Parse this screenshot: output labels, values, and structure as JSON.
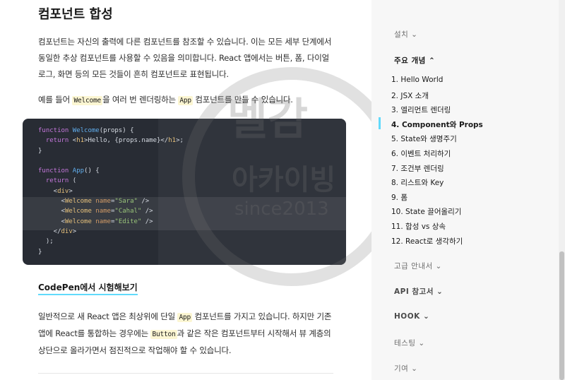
{
  "main": {
    "heading": "컴포넌트 합성",
    "p1": "컴포넌트는 자신의 출력에 다른 컴포넌트를 참조할 수 있습니다. 이는 모든 세부 단계에서 동일한 추상 컴포넌트를 사용할 수 있음을 의미합니다. React 앱에서는 버튼, 폼, 다이얼로그, 화면 등의 모든 것들이 흔히 컴포넌트로 표현됩니다.",
    "p2_before": "예를 들어 ",
    "p2_code1": "Welcome",
    "p2_mid": "을 여러 번 렌더링하는 ",
    "p2_code2": "App",
    "p2_after": " 컴포넌트를 만들 수 있습니다.",
    "code_lines": [
      "function Welcome(props) {",
      "  return <h1>Hello, {props.name}</h1>;",
      "}",
      "",
      "function App() {",
      "  return (",
      "    <div>",
      "      <Welcome name=\"Sara\" />",
      "      <Welcome name=\"Cahal\" />",
      "      <Welcome name=\"Edite\" />",
      "    </div>",
      "  );",
      "}"
    ],
    "codepen_link": "CodePen에서 시험해보기",
    "p3_before": "일반적으로 새 React 앱은 최상위에 단일 ",
    "p3_code1": "App",
    "p3_mid": " 컴포넌트를 가지고 있습니다. 하지만 기존 앱에 React를 통합하는 경우에는 ",
    "p3_code2": "Button",
    "p3_after": "과 같은 작은 컴포넌트부터 시작해서 뷰 계층의 상단으로 올라가면서 점진적으로 작업해야 할 수 있습니다."
  },
  "watermark": {
    "line1": "멜감",
    "line2": "아카이빙",
    "line3": "since2013"
  },
  "sidebar": {
    "install": "설치",
    "main_concepts": "주요 개념",
    "items": [
      "1. Hello World",
      "2. JSX 소개",
      "3. 엘리먼트 렌더링",
      "4. Component와 Props",
      "5. State와 생명주기",
      "6. 이벤트 처리하기",
      "7. 조건부 렌더링",
      "8. 리스트와 Key",
      "9. 폼",
      "10. State 끌어올리기",
      "11. 합성 vs 상속",
      "12. React로 생각하기"
    ],
    "active_index": 3,
    "advanced": "고급 안내서",
    "api": "API 참고서",
    "hook": "HOOK",
    "testing": "테스팅",
    "contributing": "기여"
  },
  "icons": {
    "chevron_down": "chevron-down-icon",
    "chevron_up": "chevron-up-icon"
  },
  "colors": {
    "accent": "#61dafb",
    "code_bg": "#282c34",
    "inline_code_bg": "#fcf6d2",
    "sidebar_bg": "#f7f7f7"
  }
}
